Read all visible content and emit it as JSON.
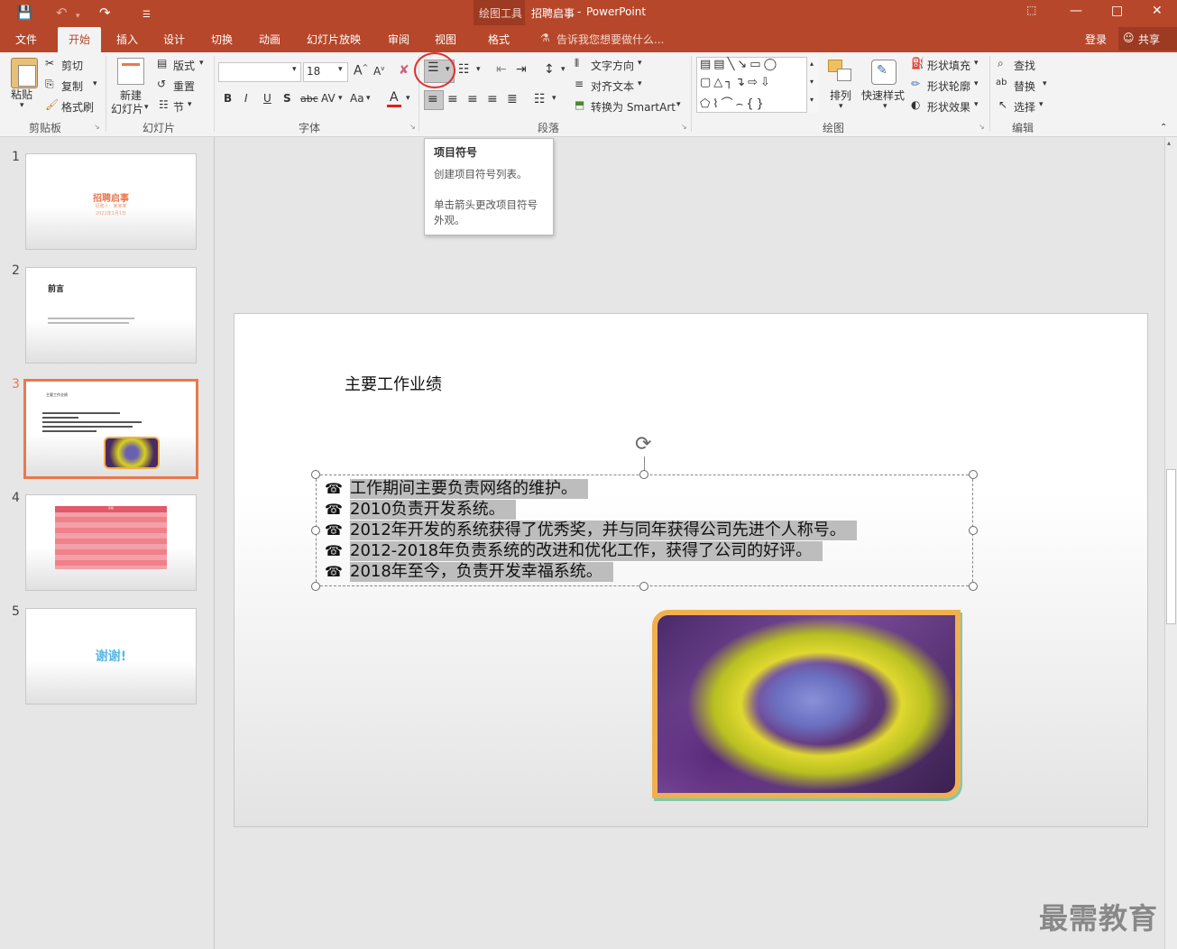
{
  "titlebar": {
    "context_label": "绘图工具",
    "doc_title": "招聘启事",
    "app_name": "PowerPoint"
  },
  "tabs": [
    {
      "label": "文件"
    },
    {
      "label": "开始"
    },
    {
      "label": "插入"
    },
    {
      "label": "设计"
    },
    {
      "label": "切换"
    },
    {
      "label": "动画"
    },
    {
      "label": "幻灯片放映"
    },
    {
      "label": "审阅"
    },
    {
      "label": "视图"
    },
    {
      "label": "格式"
    }
  ],
  "tell_me": "告诉我您想要做什么...",
  "account": {
    "login": "登录",
    "share": "共享"
  },
  "ribbon": {
    "clipboard": {
      "paste": "粘贴",
      "cut": "剪切",
      "copy": "复制",
      "format_painter": "格式刷",
      "group": "剪贴板"
    },
    "slides": {
      "new_slide_1": "新建",
      "new_slide_2": "幻灯片",
      "layout": "版式",
      "reset": "重置",
      "section": "节",
      "group": "幻灯片"
    },
    "font": {
      "size": "18",
      "bold": "B",
      "italic": "I",
      "underline": "U",
      "shadow": "S",
      "strike": "abc",
      "spacing": "AV",
      "case": "Aa",
      "color": "A",
      "group": "字体"
    },
    "paragraph": {
      "text_direction": "文字方向",
      "align_text": "对齐文本",
      "smartart": "转换为 SmartArt",
      "group": "段落"
    },
    "drawing": {
      "arrange": "排列",
      "quick_styles": "快速样式",
      "shape_fill": "形状填充",
      "shape_outline": "形状轮廓",
      "shape_effects": "形状效果",
      "group": "绘图"
    },
    "editing": {
      "find": "查找",
      "replace": "替换",
      "select": "选择",
      "group": "编辑"
    }
  },
  "tooltip": {
    "title": "项目符号",
    "line1": "创建项目符号列表。",
    "line2": "单击箭头更改项目符号外观。"
  },
  "thumbnails": [
    {
      "num": "1",
      "title": "招聘启事",
      "sub1": "招聘人：某某某",
      "sub2": "2021年1月1日"
    },
    {
      "num": "2",
      "title": "前言"
    },
    {
      "num": "3",
      "title": "主要工作业绩"
    },
    {
      "num": "4",
      "title": "表格"
    },
    {
      "num": "5",
      "title": "谢谢!"
    }
  ],
  "slide": {
    "title": "主要工作业绩",
    "bullet_icon": "telephone-bullet",
    "bullets": [
      "工作期间主要负责网络的维护。",
      "2010负责开发系统。",
      "2012年开发的系统获得了优秀奖，并与同年获得公司先进个人称号。",
      "2012-2018年负责系统的改进和优化工作，获得了公司的好评。",
      "2018年至今，负责开发幸福系统。"
    ]
  },
  "watermark": "最需教育",
  "colors": {
    "brand": "#b7472a",
    "accent": "#e9794e",
    "highlight_ring": "#e03030"
  }
}
